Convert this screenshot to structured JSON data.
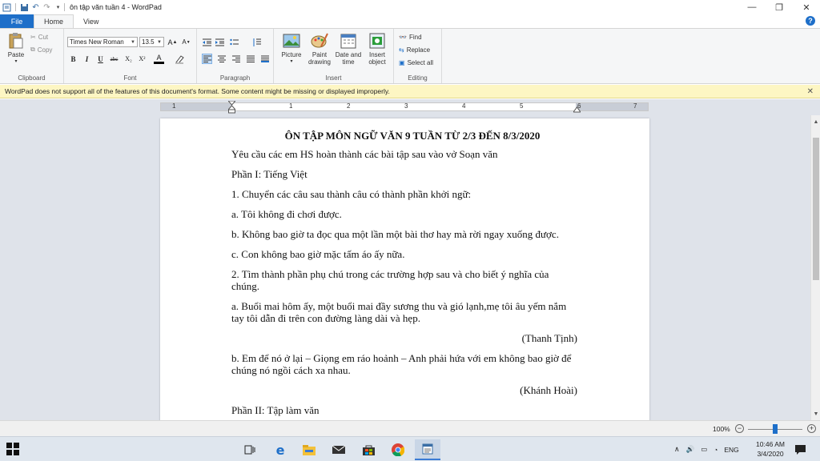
{
  "window": {
    "title": "ôn tập văn tuần 4 - WordPad",
    "title_sep": "|"
  },
  "tabs": {
    "file": "File",
    "home": "Home",
    "view": "View"
  },
  "ribbon": {
    "clipboard": {
      "paste": "Paste",
      "cut": "Cut",
      "copy": "Copy",
      "label": "Clipboard"
    },
    "font": {
      "family": "Times New Roman",
      "size": "13.5",
      "label": "Font",
      "bold": "B",
      "italic": "I",
      "underline": "U",
      "strike": "abc",
      "sub": "X₂",
      "sup": "X²",
      "color": "A"
    },
    "paragraph": {
      "label": "Paragraph"
    },
    "insert": {
      "picture": "Picture",
      "paint": "Paint drawing",
      "datetime": "Date and time",
      "object": "Insert object",
      "label": "Insert"
    },
    "editing": {
      "find": "Find",
      "replace": "Replace",
      "select_all": "Select all",
      "label": "Editing"
    }
  },
  "infobar": {
    "message": "WordPad does not support all of the features of this document's format. Some content might be missing or displayed improperly."
  },
  "ruler": {
    "numbers": [
      "1",
      "1",
      "2",
      "3",
      "4",
      "5",
      "6",
      "7"
    ]
  },
  "document": {
    "title": "ÔN TẬP MÔN NGỮ VĂN 9 TUẦN TỪ 2/3 ĐẾN 8/3/2020",
    "lines": [
      "Yêu cầu các em HS hoàn thành các bài tập sau vào vở Soạn văn",
      "Phần I: Tiếng Việt",
      "1. Chuyển các câu sau thành câu có thành phần khởi ngữ:",
      "a. Tôi không đi chơi được.",
      "b. Không bao giờ ta đọc qua một lần một bài thơ hay mà rời ngay xuống được.",
      "c. Con không bao giờ mặc tấm áo ấy nữa.",
      "2. Tìm thành phần phụ chú trong các trường hợp sau và cho biết ý nghĩa của chúng.",
      "a. Buổi mai hôm ấy, một buổi mai đầy sương thu và gió lạnh,mẹ tôi âu yếm nắm tay tôi dẫn đi trên con đường làng dài và hẹp.",
      "(Thanh Tịnh)",
      "b. Em để nó ở lại – Giọng em ráo hoảnh – Anh phải hứa với em không bao giờ để chúng nó ngồi cách xa nhau.",
      "(Khánh Hoài)",
      "Phần II: Tập làm văn"
    ]
  },
  "status": {
    "zoom": "100%"
  },
  "taskbar": {
    "lang": "ENG",
    "time": "10:46 AM",
    "date": "3/4/2020"
  }
}
